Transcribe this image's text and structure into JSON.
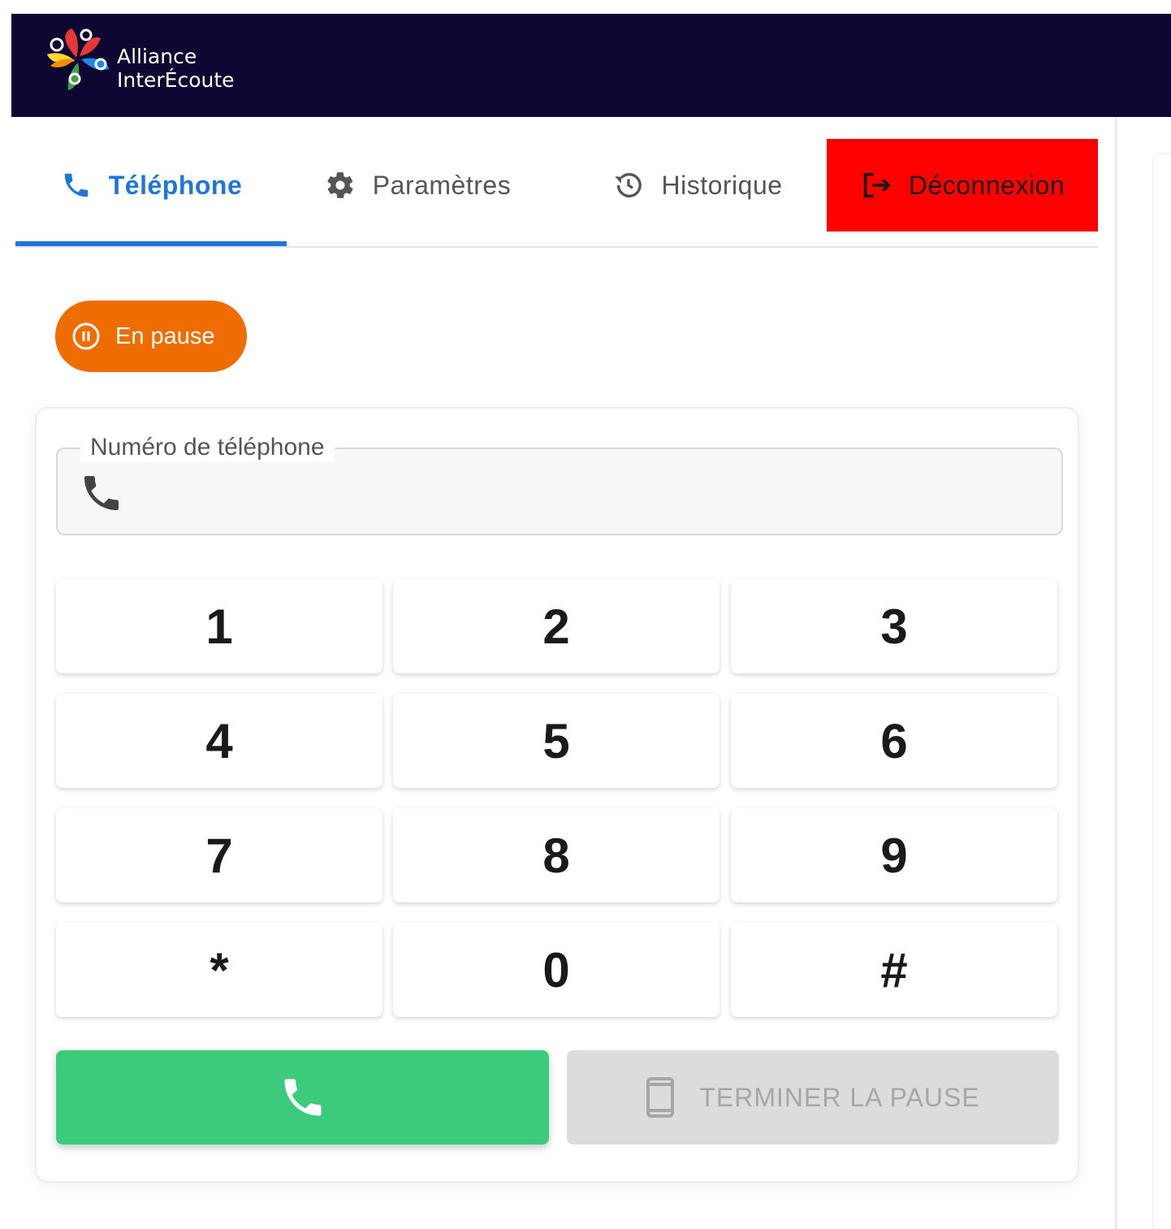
{
  "header": {
    "brand_line1": "Alliance",
    "brand_line2": "InterÉcoute",
    "logo_icon": "alliance-interecoute-logo"
  },
  "tabs": [
    {
      "label": "Téléphone",
      "icon": "phone-icon",
      "active": true
    },
    {
      "label": "Paramètres",
      "icon": "gear-icon",
      "active": false
    },
    {
      "label": "Historique",
      "icon": "history-icon",
      "active": false
    },
    {
      "label": "Déconnexion",
      "icon": "logout-icon",
      "active": false
    }
  ],
  "status": {
    "label": "En pause",
    "icon": "pause-circle-icon",
    "color": "#ef6c00"
  },
  "phone_field": {
    "label": "Numéro de téléphone",
    "value": "",
    "placeholder": ""
  },
  "keypad": [
    "1",
    "2",
    "3",
    "4",
    "5",
    "6",
    "7",
    "8",
    "9",
    "*",
    "0",
    "#"
  ],
  "actions": {
    "call_icon": "phone-icon",
    "end_pause_label": "TERMINER LA PAUSE",
    "end_pause_icon": "mobile-phone-icon",
    "end_pause_disabled": true
  },
  "colors": {
    "header_bg": "#0e0733",
    "accent": "#1e76d8",
    "logout_bg": "#fe0000",
    "call_green": "#3ccb7d",
    "pause_orange": "#ef6c00"
  }
}
